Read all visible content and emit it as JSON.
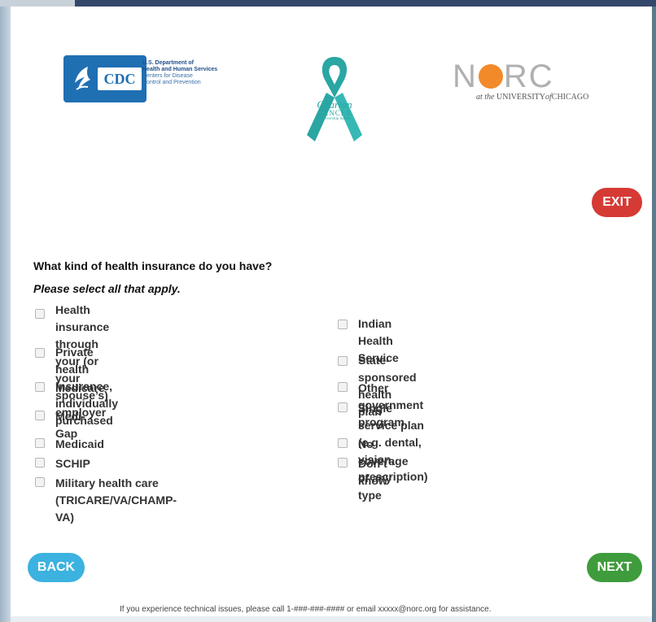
{
  "header": {
    "cdc_mark": "CDC",
    "hhs_lines": [
      "U.S. Department of",
      "Health and Human Services"
    ],
    "cdc_lines": [
      "Centers for Disease",
      "Control and Prevention"
    ],
    "survey_logo": {
      "line1": "Ovarian",
      "line2": "CANCER",
      "line3": "Survivorship Survey"
    },
    "norc": {
      "prefix": "N",
      "suffix": "RC",
      "sub_pre": "at the ",
      "sub_uni": "UNIVERSITY",
      "sub_of": "of",
      "sub_city": "CHICAGO"
    }
  },
  "exit_label": "EXIT",
  "question": "What kind of health insurance do you have?",
  "instruction": "Please select all that apply.",
  "options_left": [
    {
      "lines": [
        "Health insurance through your (or your",
        "spouse’s) employer"
      ]
    },
    {
      "lines": [
        "Private health insurance, individually",
        "purchased"
      ]
    },
    {
      "lines": [
        "Medicare"
      ]
    },
    {
      "lines": [
        "Medi-Gap"
      ]
    },
    {
      "lines": [
        "Medicaid"
      ]
    },
    {
      "lines": [
        "SCHIP"
      ]
    },
    {
      "lines": [
        "Military health care (TRICARE/VA/CHAMP-VA)"
      ]
    }
  ],
  "options_right": [
    {
      "lines": [
        "Indian Health Service"
      ]
    },
    {
      "lines": [
        "State-sponsored health plan"
      ]
    },
    {
      "lines": [
        "Other government program"
      ]
    },
    {
      "lines": [
        "Single service plan (e.g. dental, vision,",
        "prescription)"
      ]
    },
    {
      "lines": [
        "No coverage of any type"
      ]
    },
    {
      "lines": [
        "Don’t know"
      ]
    }
  ],
  "back_label": "BACK",
  "next_label": "NEXT",
  "footer": "If you experience technical issues, please call 1-###-###-#### or email xxxxx@norc.org for assistance.",
  "colors": {
    "exit": "#d63a35",
    "back": "#3bb2e0",
    "next": "#3f9c3c",
    "ribbon": "#2aa6a3",
    "cdc": "#1f6fb3"
  }
}
